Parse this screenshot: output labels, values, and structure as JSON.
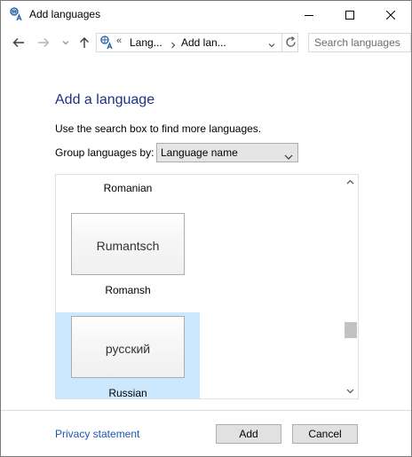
{
  "window": {
    "title": "Add languages",
    "icons": {
      "app": "language-icon",
      "minimize": "minimize-icon",
      "maximize": "maximize-icon",
      "close": "close-icon"
    }
  },
  "navbar": {
    "overflow_chevron": "«",
    "breadcrumbs": [
      "Lang...",
      "Add lan..."
    ],
    "search_placeholder": "Search languages",
    "icons": {
      "back": "back-arrow-icon",
      "forward": "forward-arrow-icon",
      "recent": "chevron-down-icon",
      "up": "up-arrow-icon",
      "refresh": "refresh-icon"
    }
  },
  "content": {
    "heading": "Add a language",
    "hint": "Use the search box to find more languages.",
    "group_label": "Group languages by:",
    "group_value": "Language name",
    "languages": [
      {
        "name": "Romanian",
        "native": "",
        "selected": false
      },
      {
        "name": "Romansh",
        "native": "Rumantsch",
        "selected": false
      },
      {
        "name": "Russian",
        "native": "русский",
        "selected": true
      }
    ],
    "scroll_position": 0.72
  },
  "footer": {
    "privacy_link": "Privacy statement",
    "add_label": "Add",
    "cancel_label": "Cancel"
  },
  "colors": {
    "heading": "#1e3287",
    "link": "#1a56b0",
    "selection": "#cce8ff"
  }
}
